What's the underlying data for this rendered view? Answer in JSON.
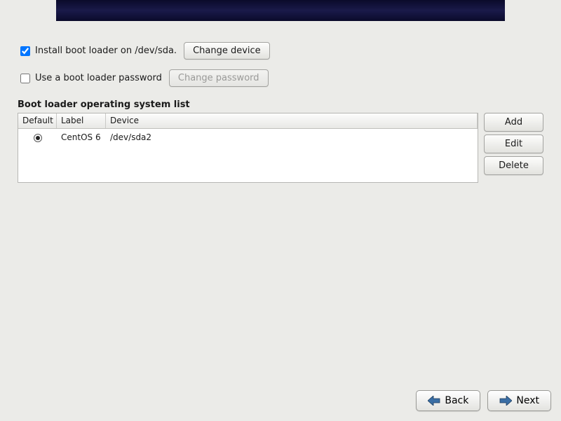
{
  "install_bootloader": {
    "checked": true,
    "label": "Install boot loader on /dev/sda.",
    "change_button": "Change device"
  },
  "use_password": {
    "checked": false,
    "label": "Use a boot loader password",
    "change_button": "Change password"
  },
  "os_list": {
    "heading": "Boot loader operating system list",
    "columns": {
      "default": "Default",
      "label": "Label",
      "device": "Device"
    },
    "rows": [
      {
        "default": true,
        "label": "CentOS 6",
        "device": "/dev/sda2"
      }
    ],
    "buttons": {
      "add": "Add",
      "edit": "Edit",
      "delete": "Delete"
    }
  },
  "nav": {
    "back": "Back",
    "next": "Next"
  }
}
